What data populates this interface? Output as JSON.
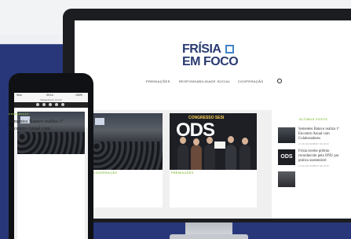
{
  "site": {
    "logo_line1": "FRÍSIA",
    "logo_line2": "EM FOCO"
  },
  "nav": {
    "items": [
      "PREMIAÇÕES",
      "RESPONSABILIDADE SOCIAL",
      "COOPERAÇÃO"
    ]
  },
  "cards": [
    {
      "tag": "COOPERAÇÃO"
    },
    {
      "tag": "PREMIAÇÕES",
      "image_text": "ODS",
      "image_banner": "CONGRESSO SESI"
    }
  ],
  "sidebar": {
    "title": "ÚLTIMOS POSTS",
    "items": [
      {
        "title": "Sementes Batavo realiza 1º Encontro Anual com Colaboradores",
        "date": "21 DE SETEMBRO DE 2018"
      },
      {
        "title": "Frísia recebe prêmio reconhecido pela ONU por prática sustentável",
        "date": "21 DE SETEMBRO DE 2018"
      }
    ]
  },
  "phone": {
    "status_left": "Vivo",
    "status_time": "09:14",
    "status_right": "100%",
    "url": "friasiaemfoco.com.br",
    "tag": "COOPERAÇÃO",
    "title": "Sementes Batavo realiza 1º Encontro Anual com"
  },
  "colors": {
    "brand_blue": "#2a3b72",
    "accent_green": "#8cc04a",
    "background_blue": "#28377a"
  }
}
